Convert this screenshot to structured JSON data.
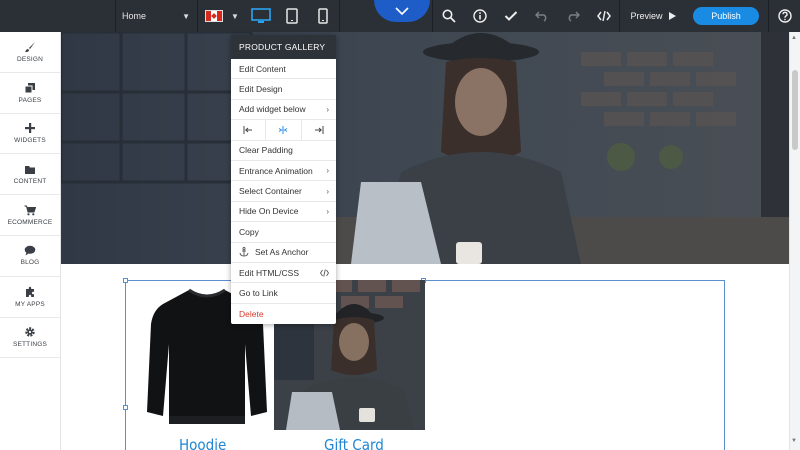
{
  "topbar": {
    "page_select": "Home",
    "preview_label": "Preview",
    "publish_label": "Publish"
  },
  "sidebar": {
    "items": [
      {
        "label": "DESIGN",
        "icon": "brush-icon"
      },
      {
        "label": "PAGES",
        "icon": "pages-icon"
      },
      {
        "label": "WIDGETS",
        "icon": "plus-icon"
      },
      {
        "label": "CONTENT",
        "icon": "folder-icon"
      },
      {
        "label": "ECOMMERCE",
        "icon": "cart-icon"
      },
      {
        "label": "BLOG",
        "icon": "chat-bubble-icon"
      },
      {
        "label": "MY APPS",
        "icon": "puzzle-icon"
      },
      {
        "label": "SETTINGS",
        "icon": "gear-icon"
      }
    ]
  },
  "menu": {
    "header": "PRODUCT GALLERY",
    "items": {
      "edit_content": "Edit Content",
      "edit_design": "Edit Design",
      "add_widget_below": "Add widget below",
      "clear_padding": "Clear Padding",
      "entrance_animation": "Entrance Animation",
      "select_container": "Select Container",
      "hide_on_device": "Hide On Device",
      "copy": "Copy",
      "set_as_anchor": "Set As Anchor",
      "edit_html_css": "Edit HTML/CSS",
      "go_to_link": "Go to Link",
      "delete": "Delete"
    }
  },
  "gallery": {
    "products": [
      {
        "title": "Hoodie"
      },
      {
        "title": "Gift Card"
      }
    ]
  },
  "colors": {
    "topbar_bg": "#2b3036",
    "accent": "#1a8be2",
    "delete": "#d43a2f",
    "product_title": "#1f86d3"
  }
}
